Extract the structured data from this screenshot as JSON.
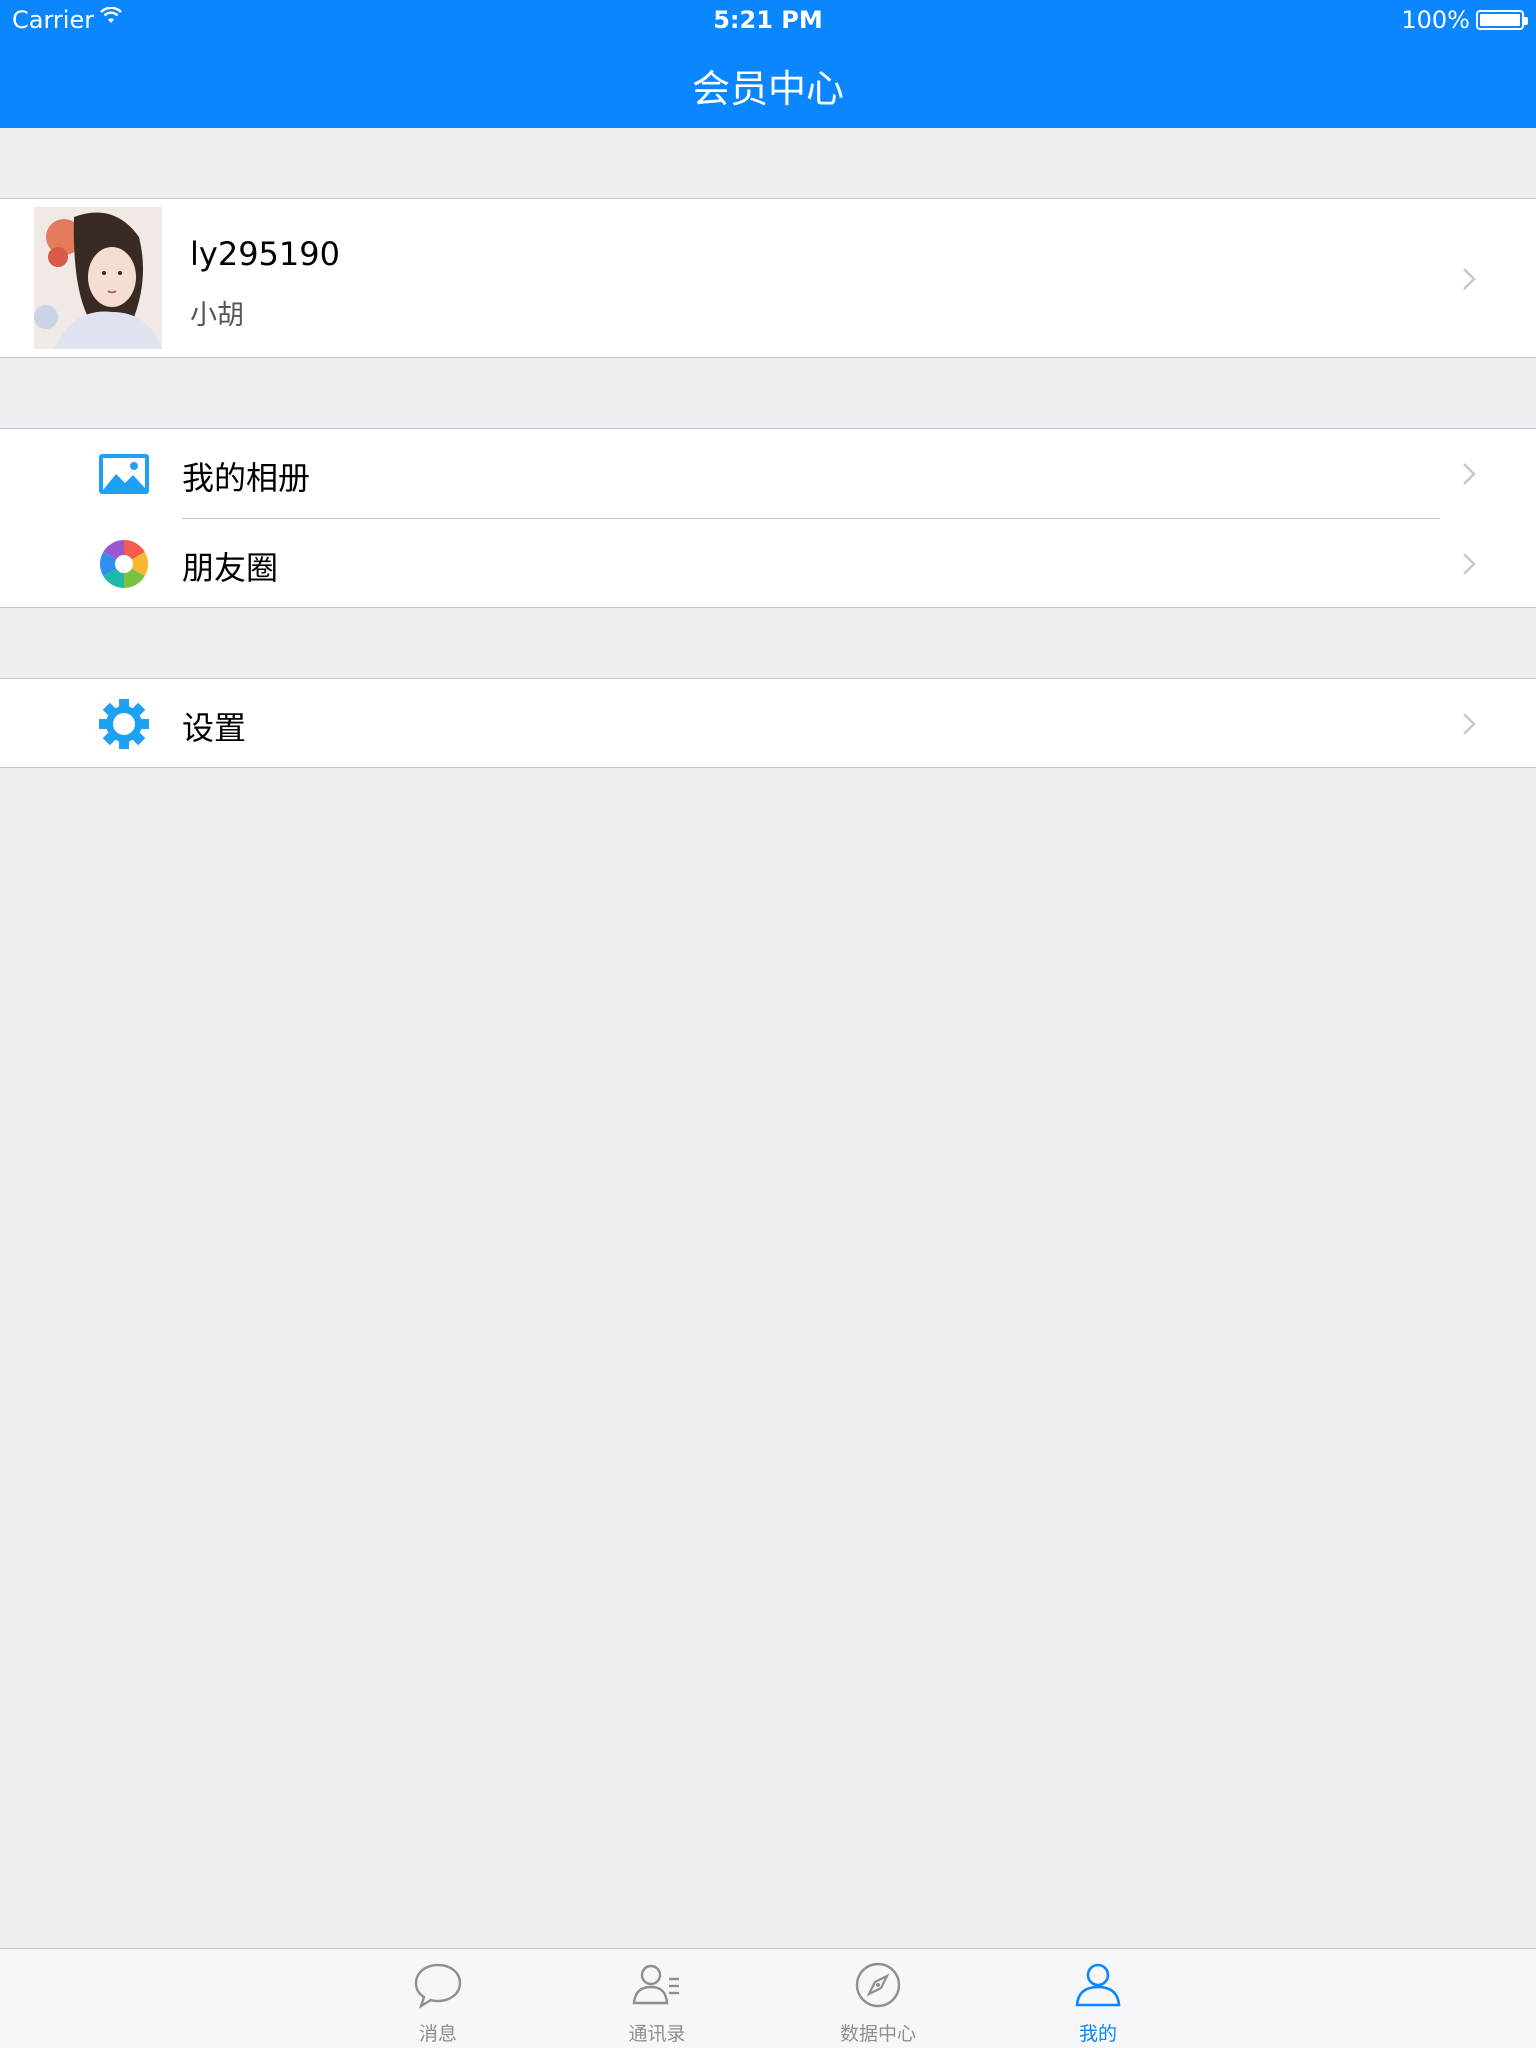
{
  "status_bar": {
    "carrier": "Carrier",
    "time": "5:21 PM",
    "battery": "100%"
  },
  "nav": {
    "title": "会员中心"
  },
  "profile": {
    "username": "ly295190",
    "nickname": "小胡"
  },
  "menu": {
    "album_label": "我的相册",
    "moments_label": "朋友圈",
    "settings_label": "设置"
  },
  "tabs": [
    {
      "label": "消息",
      "icon": "chat-bubble-icon",
      "active": false
    },
    {
      "label": "通讯录",
      "icon": "contacts-icon",
      "active": false
    },
    {
      "label": "数据中心",
      "icon": "compass-icon",
      "active": false
    },
    {
      "label": "我的",
      "icon": "person-icon",
      "active": true
    }
  ],
  "colors": {
    "accent": "#0a86fe",
    "background": "#eeeef3",
    "inactive": "#8e8e93"
  }
}
